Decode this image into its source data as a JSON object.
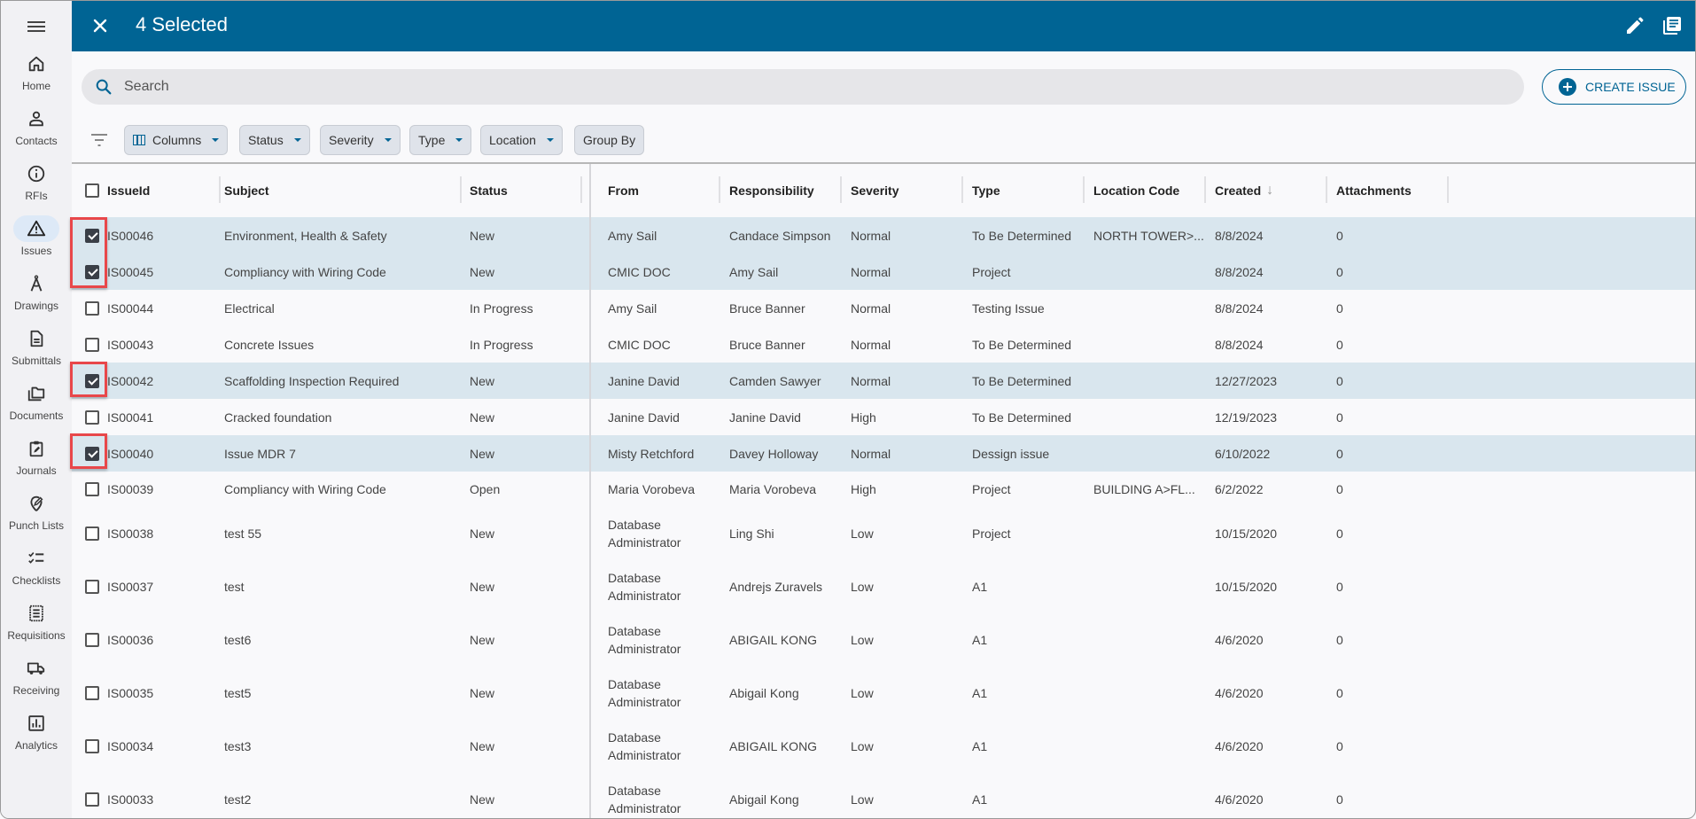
{
  "app_bar": {
    "title": "4 Selected",
    "close_icon": "close-icon",
    "actions": [
      "edit-icon",
      "library-books-icon"
    ]
  },
  "sidebar": {
    "menu_icon": "hamburger-icon",
    "items": [
      {
        "label": "Home",
        "icon": "home-icon",
        "active": false
      },
      {
        "label": "Contacts",
        "icon": "person-icon",
        "active": false
      },
      {
        "label": "RFIs",
        "icon": "info-icon",
        "active": false
      },
      {
        "label": "Issues",
        "icon": "warning-icon",
        "active": true
      },
      {
        "label": "Drawings",
        "icon": "compass-icon",
        "active": false
      },
      {
        "label": "Submittals",
        "icon": "document-icon",
        "active": false
      },
      {
        "label": "Documents",
        "icon": "folders-icon",
        "active": false
      },
      {
        "label": "Journals",
        "icon": "clipboard-edit-icon",
        "active": false
      },
      {
        "label": "Punch Lists",
        "icon": "tag-edit-icon",
        "active": false
      },
      {
        "label": "Checklists",
        "icon": "checklist-icon",
        "active": false
      },
      {
        "label": "Requisitions",
        "icon": "receipt-icon",
        "active": false
      },
      {
        "label": "Receiving",
        "icon": "truck-icon",
        "active": false
      },
      {
        "label": "Analytics",
        "icon": "bar-chart-icon",
        "active": false
      }
    ]
  },
  "search": {
    "placeholder": "Search",
    "value": ""
  },
  "create_button": {
    "label": "CREATE ISSUE"
  },
  "filters": {
    "chips": [
      {
        "label": "Columns",
        "dropdown": true
      },
      {
        "label": "Status",
        "dropdown": true
      },
      {
        "label": "Severity",
        "dropdown": true
      },
      {
        "label": "Type",
        "dropdown": true
      },
      {
        "label": "Location",
        "dropdown": true
      },
      {
        "label": "Group By",
        "dropdown": false
      }
    ]
  },
  "table": {
    "columns": [
      "IssueId",
      "Subject",
      "Status",
      "From",
      "Responsibility",
      "Severity",
      "Type",
      "Location Code",
      "Created",
      "Attachments"
    ],
    "sort": {
      "column": "Created",
      "direction": "desc"
    },
    "rows": [
      {
        "selected": true,
        "id": "IS00046",
        "subject": "Environment, Health & Safety",
        "status": "New",
        "from": "Amy Sail",
        "responsibility": "Candace Simpson",
        "severity": "Normal",
        "type": "To Be Determined",
        "location": "NORTH TOWER>...",
        "created": "8/8/2024",
        "attachments": "0"
      },
      {
        "selected": true,
        "id": "IS00045",
        "subject": "Compliancy with Wiring Code",
        "status": "New",
        "from": "CMIC DOC",
        "responsibility": "Amy Sail",
        "severity": "Normal",
        "type": "Project",
        "location": "",
        "created": "8/8/2024",
        "attachments": "0"
      },
      {
        "selected": false,
        "id": "IS00044",
        "subject": "Electrical",
        "status": "In Progress",
        "from": "Amy Sail",
        "responsibility": "Bruce Banner",
        "severity": "Normal",
        "type": "Testing Issue",
        "location": "",
        "created": "8/8/2024",
        "attachments": "0"
      },
      {
        "selected": false,
        "id": "IS00043",
        "subject": "Concrete Issues",
        "status": "In Progress",
        "from": "CMIC DOC",
        "responsibility": "Bruce Banner",
        "severity": "Normal",
        "type": "To Be Determined",
        "location": "",
        "created": "8/8/2024",
        "attachments": "0"
      },
      {
        "selected": true,
        "id": "IS00042",
        "subject": "Scaffolding Inspection Required",
        "status": "New",
        "from": "Janine David",
        "responsibility": "Camden Sawyer",
        "severity": "Normal",
        "type": "To Be Determined",
        "location": "",
        "created": "12/27/2023",
        "attachments": "0"
      },
      {
        "selected": false,
        "id": "IS00041",
        "subject": "Cracked foundation",
        "status": "New",
        "from": "Janine David",
        "responsibility": "Janine David",
        "severity": "High",
        "type": "To Be Determined",
        "location": "",
        "created": "12/19/2023",
        "attachments": "0"
      },
      {
        "selected": true,
        "id": "IS00040",
        "subject": "Issue MDR 7",
        "status": "New",
        "from": "Misty Retchford",
        "responsibility": "Davey Holloway",
        "severity": "Normal",
        "type": "Dessign issue",
        "location": "",
        "created": "6/10/2022",
        "attachments": "0"
      },
      {
        "selected": false,
        "id": "IS00039",
        "subject": "Compliancy with Wiring Code",
        "status": "Open",
        "from": "Maria Vorobeva",
        "responsibility": "Maria Vorobeva",
        "severity": "High",
        "type": "Project",
        "location": "BUILDING A>FL...",
        "created": "6/2/2022",
        "attachments": "0"
      },
      {
        "selected": false,
        "id": "IS00038",
        "subject": "test 55",
        "status": "New",
        "from": "Database Administrator",
        "responsibility": "Ling Shi",
        "severity": "Low",
        "type": "Project",
        "location": "",
        "created": "10/15/2020",
        "attachments": "0"
      },
      {
        "selected": false,
        "id": "IS00037",
        "subject": "test",
        "status": "New",
        "from": "Database Administrator",
        "responsibility": "Andrejs Zuravels",
        "severity": "Low",
        "type": "A1",
        "location": "",
        "created": "10/15/2020",
        "attachments": "0"
      },
      {
        "selected": false,
        "id": "IS00036",
        "subject": "test6",
        "status": "New",
        "from": "Database Administrator",
        "responsibility": "ABIGAIL KONG",
        "severity": "Low",
        "type": "A1",
        "location": "",
        "created": "4/6/2020",
        "attachments": "0"
      },
      {
        "selected": false,
        "id": "IS00035",
        "subject": "test5",
        "status": "New",
        "from": "Database Administrator",
        "responsibility": "Abigail Kong",
        "severity": "Low",
        "type": "A1",
        "location": "",
        "created": "4/6/2020",
        "attachments": "0"
      },
      {
        "selected": false,
        "id": "IS00034",
        "subject": "test3",
        "status": "New",
        "from": "Database Administrator",
        "responsibility": "ABIGAIL KONG",
        "severity": "Low",
        "type": "A1",
        "location": "",
        "created": "4/6/2020",
        "attachments": "0"
      },
      {
        "selected": false,
        "id": "IS00033",
        "subject": "test2",
        "status": "New",
        "from": "Database Administrator",
        "responsibility": "Abigail Kong",
        "severity": "Low",
        "type": "A1",
        "location": "",
        "created": "4/6/2020",
        "attachments": "0"
      }
    ]
  },
  "colors": {
    "app_bar": "#006494",
    "accent": "#006494",
    "selected_row": "#d9e6ee",
    "highlight_box": "#e8474a",
    "sidebar_bg": "#f1f1f4",
    "active_nav_bg": "#dde9f7"
  }
}
